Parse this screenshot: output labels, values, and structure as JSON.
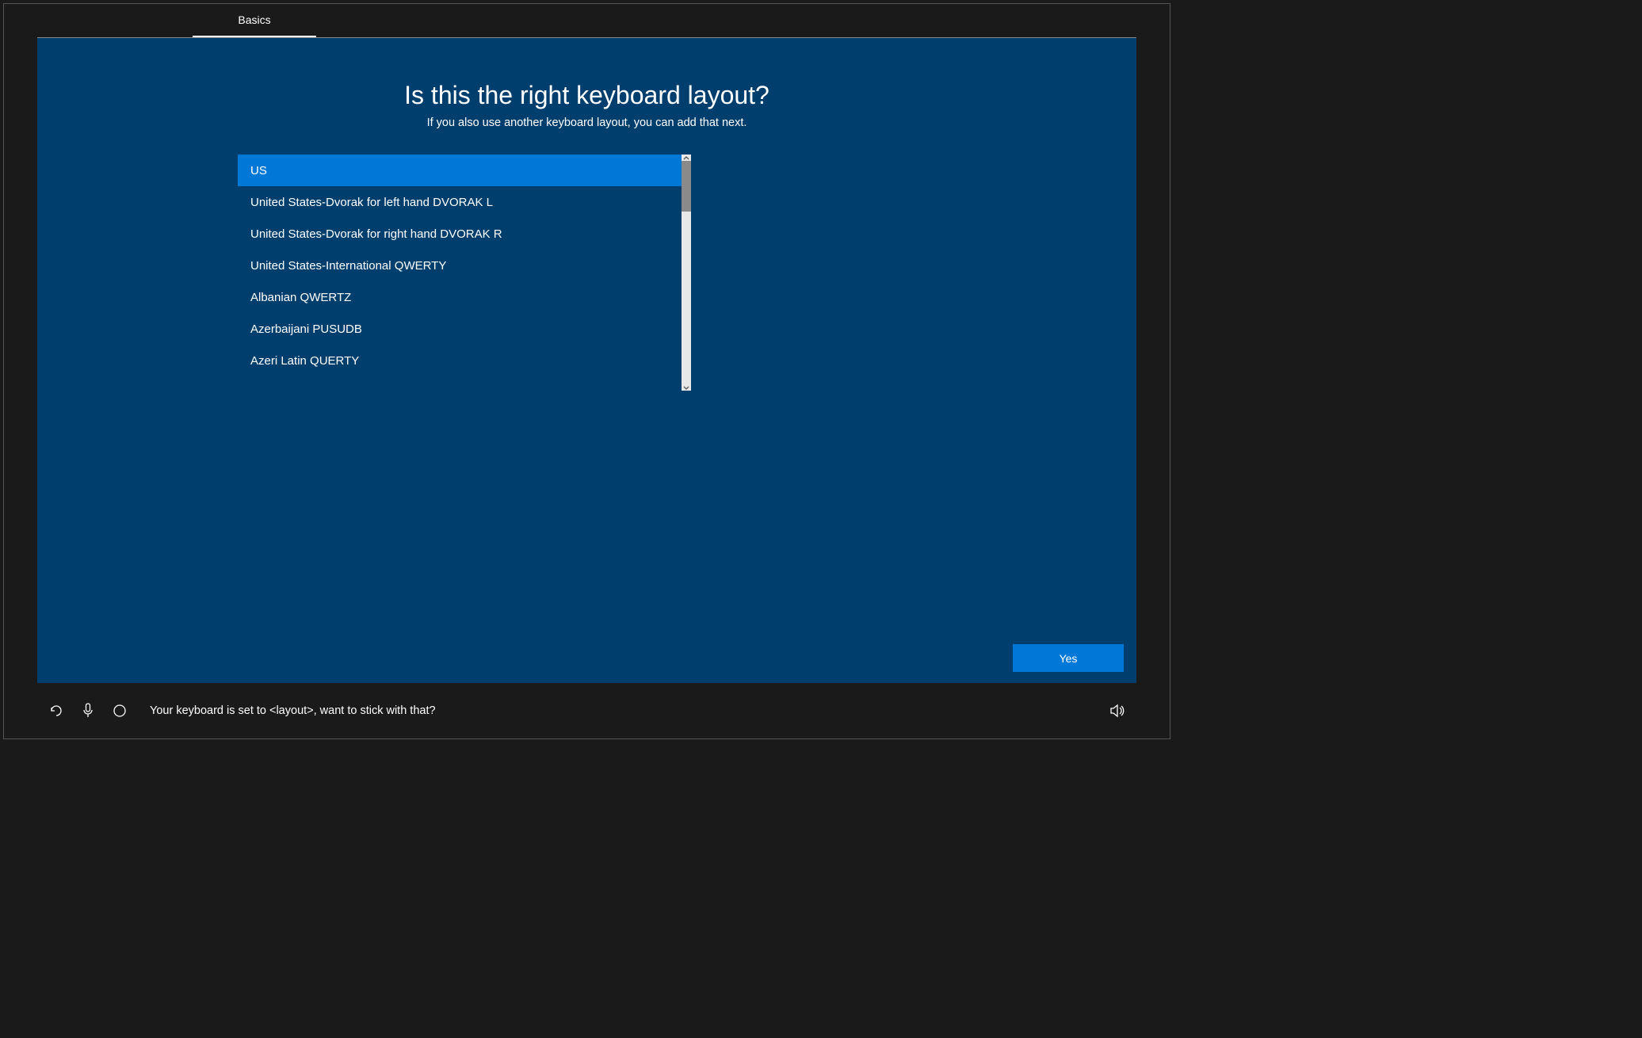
{
  "tab": {
    "label": "Basics"
  },
  "heading": "Is this the right keyboard layout?",
  "subheading": "If you also use another keyboard layout, you can add that next.",
  "keyboardLayouts": [
    {
      "label": "US",
      "selected": true
    },
    {
      "label": "United States-Dvorak for left hand DVORAK L",
      "selected": false
    },
    {
      "label": "United States-Dvorak for right hand DVORAK R",
      "selected": false
    },
    {
      "label": "United States-International QWERTY",
      "selected": false
    },
    {
      "label": "Albanian QWERTZ",
      "selected": false
    },
    {
      "label": "Azerbaijani PUSUDB",
      "selected": false
    },
    {
      "label": "Azeri Latin QUERTY",
      "selected": false
    }
  ],
  "yesButton": "Yes",
  "cortanaText": "Your keyboard is set to <layout>, want to stick with that?"
}
